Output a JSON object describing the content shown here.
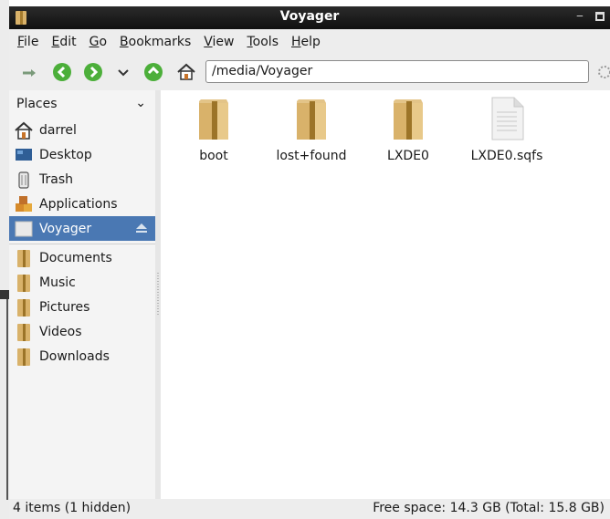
{
  "window": {
    "title": "Voyager"
  },
  "menu": [
    "File",
    "Edit",
    "Go",
    "Bookmarks",
    "View",
    "Tools",
    "Help"
  ],
  "toolbar": {
    "path": "/media/Voyager"
  },
  "sidebar": {
    "header": "Places",
    "places": [
      {
        "label": "darrel",
        "icon": "home-icon"
      },
      {
        "label": "Desktop",
        "icon": "desktop-icon"
      },
      {
        "label": "Trash",
        "icon": "trash-icon"
      },
      {
        "label": "Applications",
        "icon": "applications-icon"
      },
      {
        "label": "Voyager",
        "icon": "drive-icon",
        "selected": true
      }
    ],
    "bookmarks": [
      {
        "label": "Documents",
        "icon": "folder-icon"
      },
      {
        "label": "Music",
        "icon": "folder-icon"
      },
      {
        "label": "Pictures",
        "icon": "folder-icon"
      },
      {
        "label": "Videos",
        "icon": "folder-icon"
      },
      {
        "label": "Downloads",
        "icon": "folder-icon"
      }
    ]
  },
  "files": [
    {
      "name": "boot",
      "icon": "folder-icon"
    },
    {
      "name": "lost+found",
      "icon": "folder-icon"
    },
    {
      "name": "LXDE0",
      "icon": "folder-icon"
    },
    {
      "name": "LXDE0.sqfs",
      "icon": "file-icon"
    }
  ],
  "status": {
    "left": "4 items (1 hidden)",
    "right": "Free space: 14.3 GB (Total: 15.8 GB)"
  },
  "colors": {
    "selection": "#4a78b3",
    "folder": "#d9b26a",
    "titlebar": "#1a1a1a"
  }
}
